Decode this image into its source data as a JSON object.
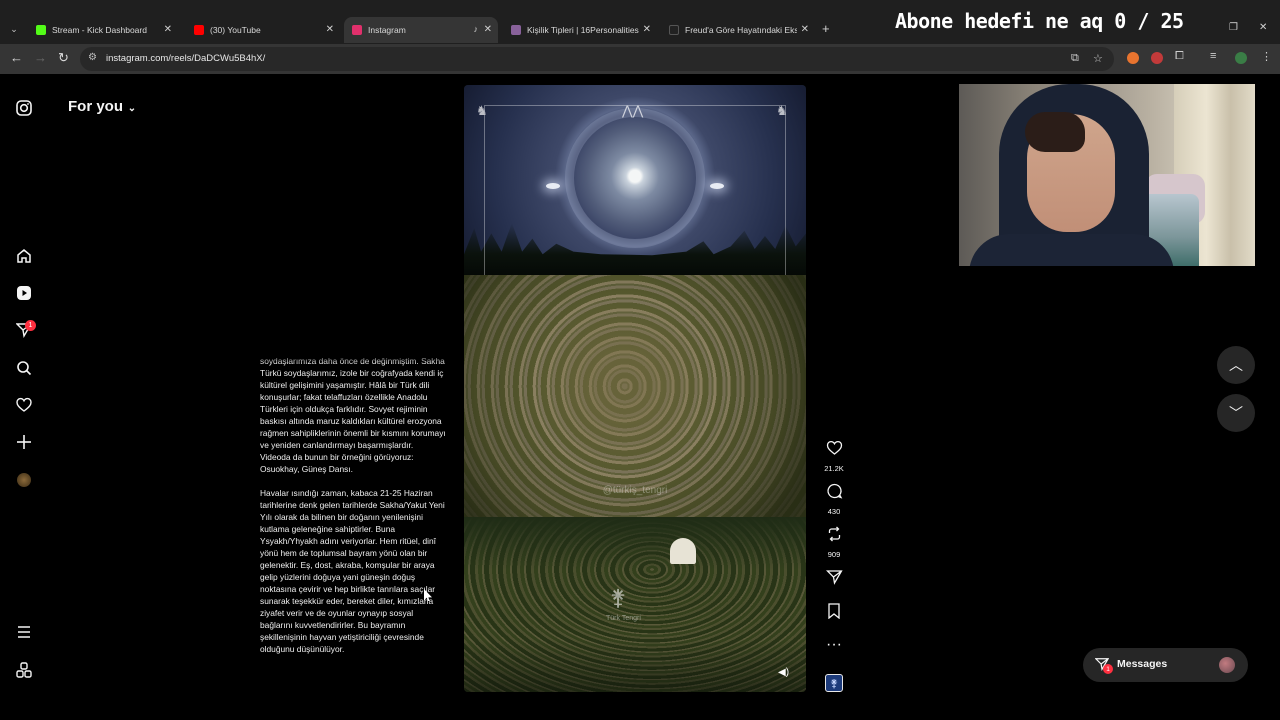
{
  "stream_overlay": "Abone hedefi ne aq 0 / 25",
  "browser": {
    "tabs": [
      {
        "title": "Stream - Kick Dashboard",
        "favicon_color": "#53fc18"
      },
      {
        "title": "(30) YouTube",
        "favicon_color": "#ff0000"
      },
      {
        "title": "Instagram",
        "favicon_color": "#e1306c",
        "active": true,
        "audio": true
      },
      {
        "title": "Kişilik Tipleri | 16Personalities",
        "favicon_color": "#88619a"
      },
      {
        "title": "Freud'a Göre Hayatındaki Eksik",
        "favicon_color": "#222222"
      }
    ],
    "new_tab": "+",
    "url": "instagram.com/reels/DaDCWu5B4hX/"
  },
  "instagram": {
    "feed_selector": "For you",
    "nav_badge": "1",
    "caption": [
      "soydaşlarımıza daha önce de değinmiştim. Sakha Türkü soydaşlarımız, izole bir coğrafyada kendi iç kültürel gelişimini yaşamıştır. Hâlâ bir Türk dili konuşurlar; fakat telaffuzları özellikle Anadolu Türkleri için oldukça farklıdır. Sovyet rejiminin baskısı altında maruz kaldıkları kültürel erozyona rağmen sahipliklerinin önemli bir kısmını korumayı ve yeniden canlandırmayı başarmışlardır. Videoda da bunun bir örneğini görüyoruz: Osuokhay, Güneş Dansı.",
      "Havalar ısındığı zaman, kabaca 21-25 Haziran tarihlerine denk gelen tarihlerde Sakha/Yakut Yeni Yılı olarak da bilinen bir doğanın yenilenişini kutlama geleneğine sahiptirler. Buna Ysyakh/Yhyakh adını veriyorlar. Hem ritüel, dinî yönü hem de toplumsal bayram yönü olan bir gelenektir. Eş, dost, akraba, komşular bir araya gelip yüzlerini doğuya yani güneşin doğuş noktasına çevirir ve hep birlikte tanrılara saçılar sunarak teşekkür eder, bereket diler, kımızlarla ziyafet verir ve de oyunlar oynayıp sosyal bağlarını kuvvetlendirirler. Bu bayramın şekillenişinin hayvan yetiştiriciliği çevresinde olduğunu düşünülüyor."
    ],
    "reel": {
      "watermark": "@türkiş_tengri",
      "emblem_text": "Türk Tengri"
    },
    "counts": {
      "likes": "21.2K",
      "comments": "430",
      "reposts": "909"
    },
    "messages": {
      "label": "Messages",
      "badge": "1"
    }
  }
}
